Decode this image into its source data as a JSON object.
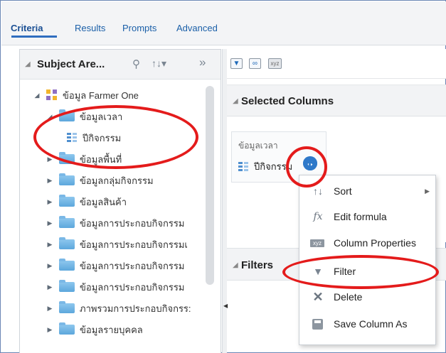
{
  "tabs": [
    {
      "label": "Criteria",
      "active": true
    },
    {
      "label": "Results",
      "active": false
    },
    {
      "label": "Prompts",
      "active": false
    },
    {
      "label": "Advanced",
      "active": false
    }
  ],
  "subject_panel": {
    "title": "Subject Are...",
    "tools": {
      "search": "search-icon",
      "sort": "sort-icon",
      "expand": "double-chevron-right-icon"
    }
  },
  "tree": {
    "root": "ข้อมูล Farmer One",
    "expanded_folder": "ข้อมูลเวลา",
    "expanded_child": "ปีกิจกรรม",
    "folders": [
      "ข้อมูลพื้นที่",
      "ข้อมูลกลุ่มกิจกรรม",
      "ข้อมูลสินค้า",
      "ข้อมูลการประกอบกิจกรรม",
      "ข้อมูลการประกอบกิจกรรมเ",
      "ข้อมูลการประกอบกิจกรรม",
      "ข้อมูลการประกอบกิจกรรม",
      "ภาพรวมการประกอบกิจกรร:",
      "ข้อมูลรายบุคคล"
    ]
  },
  "selected_columns": {
    "title": "Selected Columns",
    "column_folder": "ข้อมูลเวลา",
    "column_name": "ปีกิจกรรม"
  },
  "filters": {
    "title": "Filters"
  },
  "context_menu": [
    {
      "label": "Sort",
      "icon": "sort-icon",
      "submenu": true
    },
    {
      "label": "Edit formula",
      "icon": "fx-icon",
      "submenu": false
    },
    {
      "label": "Column Properties",
      "icon": "xyz-icon",
      "submenu": false
    },
    {
      "label": "Filter",
      "icon": "filter-icon",
      "submenu": false
    },
    {
      "label": "Delete",
      "icon": "delete-icon",
      "submenu": false
    },
    {
      "label": "Save Column As",
      "icon": "save-icon",
      "submenu": false
    }
  ],
  "colors": {
    "accent": "#2f6dbf",
    "annotation": "#e41b1b",
    "folder": "#5ca7dc"
  }
}
